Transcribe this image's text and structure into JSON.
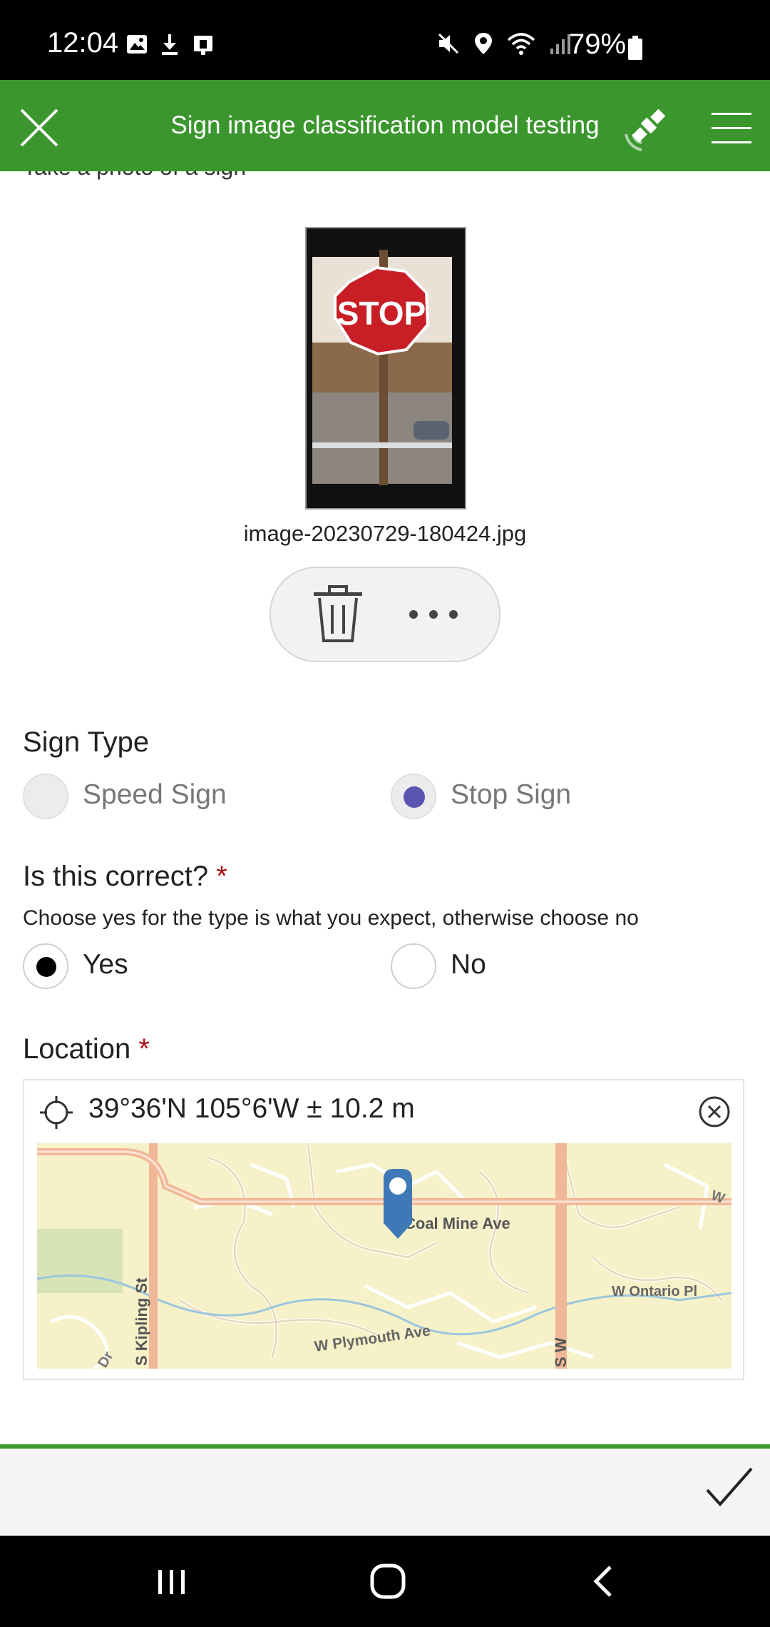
{
  "status_bar": {
    "time": "12:04",
    "battery": "79%",
    "icons_left": [
      "image-icon",
      "download-icon",
      "device-icon"
    ],
    "icons_right": [
      "mute-icon",
      "location-icon",
      "wifi-icon",
      "signal-icon",
      "battery-icon"
    ]
  },
  "header": {
    "title": "Sign image classification model testing",
    "close_icon": "close-icon",
    "gps_icon": "satellite-icon",
    "menu_icon": "hamburger-menu-icon",
    "color": "#3a962d"
  },
  "photo_question": {
    "label_partial": "Take a photo of a sign",
    "filename": "image-20230729-180424.jpg",
    "photo_text": "STOP",
    "actions": {
      "delete_icon": "trash-icon",
      "more_icon": "more-horizontal-icon"
    }
  },
  "sign_type": {
    "label": "Sign Type",
    "options": [
      {
        "label": "Speed Sign",
        "selected": false
      },
      {
        "label": "Stop Sign",
        "selected": true
      }
    ],
    "accent": "#5a55b0"
  },
  "correct_question": {
    "label": "Is this correct?",
    "required_marker": "*",
    "hint": "Choose yes for the type is what you expect, otherwise choose no",
    "options": [
      {
        "label": "Yes",
        "selected": true
      },
      {
        "label": "No",
        "selected": false
      }
    ]
  },
  "location": {
    "label": "Location",
    "required_marker": "*",
    "coords": "39°36'N 105°6'W ± 10.2 m",
    "map_labels": {
      "coal_mine": "Coal Mine Ave",
      "kipling": "S Kipling St",
      "ontario": "W Ontario Pl",
      "plymouth": "W Plymouth Ave",
      "sw": "S W",
      "dr": "Dr",
      "w": "W"
    }
  },
  "bottom_bar": {
    "submit_icon": "check-icon"
  },
  "nav_bar": {
    "recents_icon": "recents-icon",
    "home_icon": "home-icon",
    "back_icon": "back-icon"
  }
}
